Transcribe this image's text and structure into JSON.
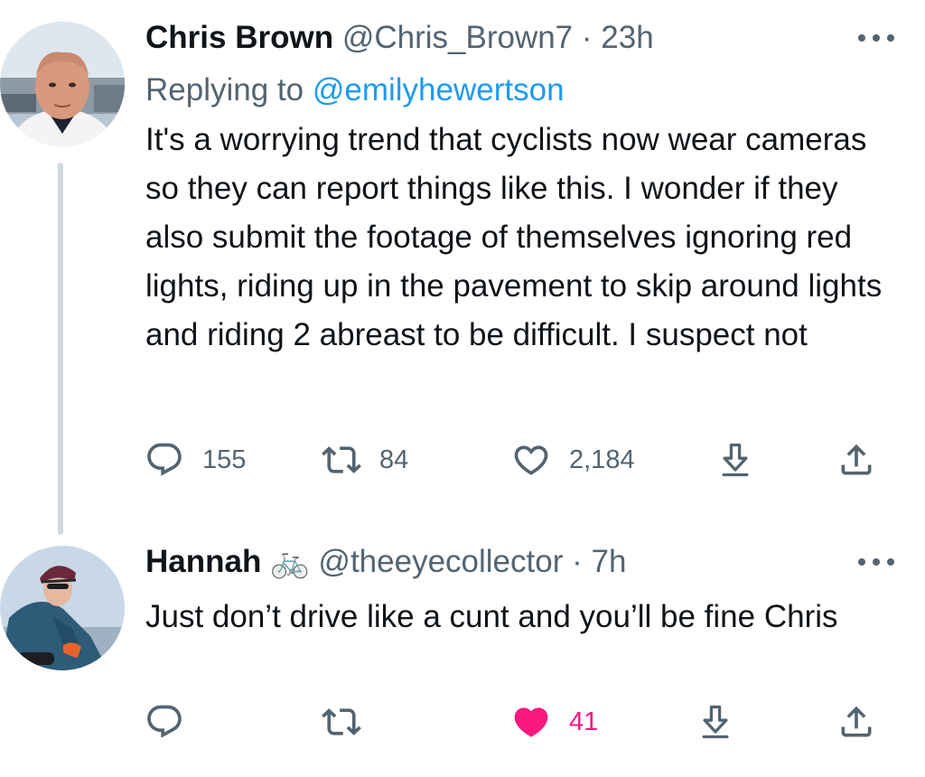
{
  "tweets": [
    {
      "author_name": "Chris Brown",
      "handle": "@Chris_Brown7",
      "separator": "·",
      "time": "23h",
      "reply_prefix": "Replying to",
      "reply_to": "@emilyhewertson",
      "text": "It's a worrying trend that cyclists now wear cameras so they can report things like this. I wonder if they also submit the footage of themselves ignoring red lights, riding up in the pavement to skip around lights and riding 2 abreast to be difficult. I suspect not",
      "replies": "155",
      "retweets": "84",
      "likes": "2,184",
      "liked": false
    },
    {
      "author_name": "Hannah",
      "name_emoji": "🚲",
      "handle": "@theeyecollector",
      "separator": "·",
      "time": "7h",
      "text": "Just don’t drive like a cunt and you’ll be fine Chris",
      "likes": "41",
      "liked": true
    }
  ],
  "icons": {
    "reply": "reply-icon",
    "retweet": "retweet-icon",
    "like": "heart-icon",
    "bookmark": "bookmark-download-icon",
    "share": "share-icon",
    "more": "more-options-icon"
  },
  "colors": {
    "text": "#0f1419",
    "secondary": "#536471",
    "link": "#1d9bf0",
    "like": "#f91880",
    "thread_line": "#cfd9de"
  }
}
